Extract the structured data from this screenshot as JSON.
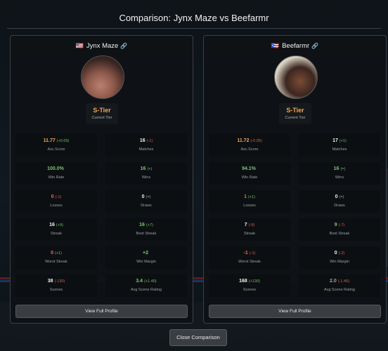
{
  "title": "Comparison: Jynx Maze vs Beefarmr",
  "close_label": "Close Comparison",
  "tier_sub_label": "Current Tier",
  "profile_button_label": "View Full Profile",
  "left": {
    "flag": "🇺🇸",
    "name": "Jynx Maze",
    "tier": "S-Tier",
    "stats": [
      {
        "value": "11.77",
        "delta": "(+0.05)",
        "label": "Asc.Score"
      },
      {
        "value": "16",
        "delta": "(-1)",
        "label": "Matches"
      },
      {
        "value": "100.0%",
        "delta": "",
        "label": "Win Rate"
      },
      {
        "value": "16",
        "delta": "(+)",
        "label": "Wins"
      },
      {
        "value": "0",
        "delta": "(-1)",
        "label": "Losses"
      },
      {
        "value": "0",
        "delta": "(=)",
        "label": "Draws"
      },
      {
        "value": "16",
        "delta": "(+9)",
        "label": "Streak"
      },
      {
        "value": "16",
        "delta": "(+7)",
        "label": "Best Streak"
      },
      {
        "value": "0",
        "delta": "(+1)",
        "label": "Worst Streak"
      },
      {
        "value": "+2",
        "delta": "",
        "label": "Win Margin"
      },
      {
        "value": "38",
        "delta": "(-130)",
        "label": "Scenes"
      },
      {
        "value": "3.4",
        "delta": "(+1.40)",
        "label": "Avg Scene Rating"
      }
    ]
  },
  "right": {
    "flag": "🇵🇷",
    "name": "Beefarmr",
    "tier": "S-Tier",
    "stats": [
      {
        "value": "11.72",
        "delta": "(-0.05)",
        "label": "Asc.Score"
      },
      {
        "value": "17",
        "delta": "(+1)",
        "label": "Matches"
      },
      {
        "value": "94.1%",
        "delta": "",
        "label": "Win Rate"
      },
      {
        "value": "16",
        "delta": "(=)",
        "label": "Wins"
      },
      {
        "value": "1",
        "delta": "(+1)",
        "label": "Losses"
      },
      {
        "value": "0",
        "delta": "(=)",
        "label": "Draws"
      },
      {
        "value": "7",
        "delta": "(-9)",
        "label": "Streak"
      },
      {
        "value": "9",
        "delta": "(-7)",
        "label": "Best Streak"
      },
      {
        "value": "-1",
        "delta": "(-1)",
        "label": "Worst Streak"
      },
      {
        "value": "0",
        "delta": "(-2)",
        "label": "Win Margin"
      },
      {
        "value": "168",
        "delta": "(+130)",
        "label": "Scenes"
      },
      {
        "value": "2.0",
        "delta": "(-1.40)",
        "label": "Avg Scene Rating"
      }
    ]
  },
  "colors": {
    "tier": "#f0a35a",
    "positive": "#7ec27a",
    "negative": "#e66a62",
    "panel": "#0e1215"
  }
}
